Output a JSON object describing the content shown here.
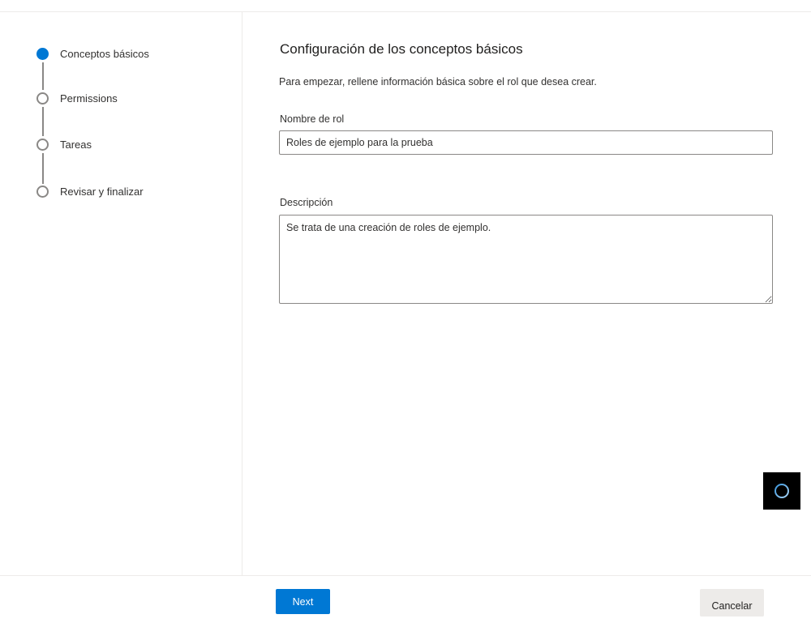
{
  "stepper": {
    "steps": [
      {
        "label": "Conceptos básicos",
        "state": "active"
      },
      {
        "label": "Permissions",
        "state": "pending"
      },
      {
        "label": "Tareas",
        "state": "pending"
      },
      {
        "label": "Revisar y finalizar",
        "state": "pending"
      }
    ]
  },
  "main": {
    "title": "Configuración de los conceptos básicos",
    "intro": "Para empezar, rellene información básica sobre el rol que desea crear.",
    "role_name": {
      "label": "Nombre de rol",
      "value": "Roles de ejemplo para la prueba"
    },
    "description": {
      "label": "Descripción",
      "value": "Se trata de una creación de roles de ejemplo."
    }
  },
  "footer": {
    "next_label": "Next",
    "cancel_label": "Cancelar"
  },
  "fab": {
    "icon": "loading-spinner-icon"
  },
  "colors": {
    "accent": "#0078d4",
    "fab_background": "#000000",
    "cancel_background": "#edebe9"
  }
}
